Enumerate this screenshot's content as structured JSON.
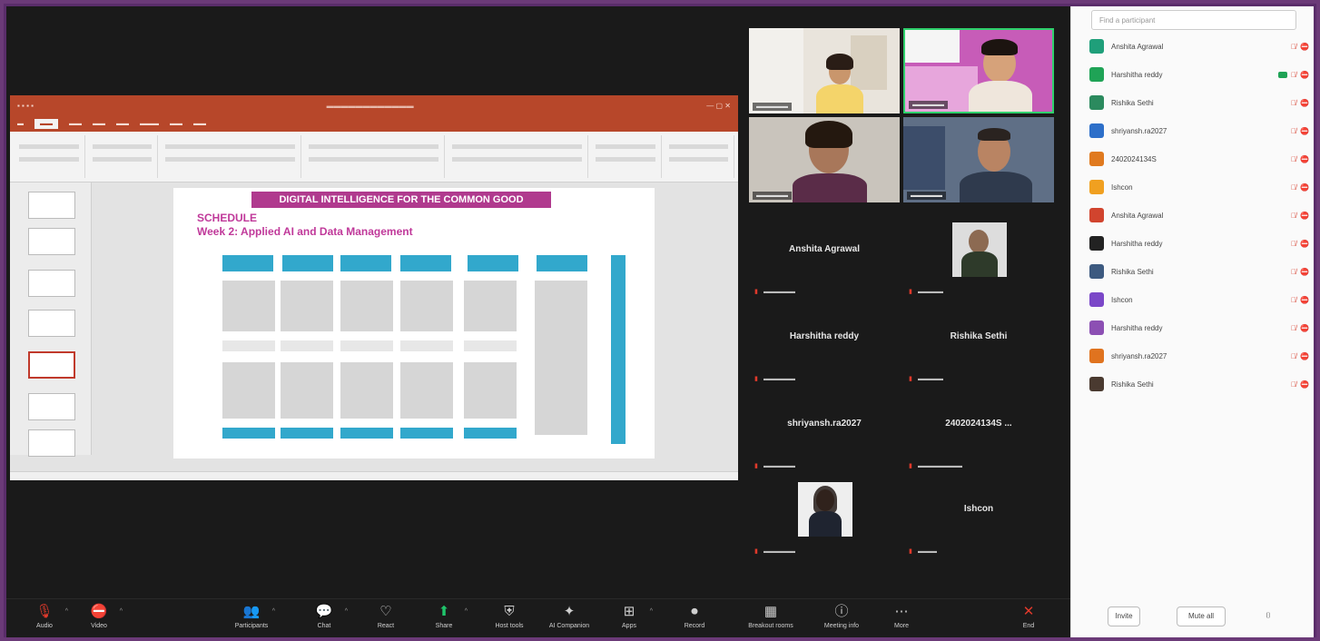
{
  "slide": {
    "banner": "DIGITAL INTELLIGENCE FOR THE COMMON GOOD",
    "heading": "SCHEDULE",
    "subheading": "Week 2: Applied AI and Data Management"
  },
  "tiles": [
    {
      "name": "Anshita Agrawal"
    },
    {
      "name": "Harshitha reddy"
    },
    {
      "name": "Rishika Sethi"
    },
    {
      "name": "shriyansh.ra2027"
    },
    {
      "name": "2402024134S ..."
    },
    {
      "name": "Ishcon"
    }
  ],
  "participants": [
    {
      "name": "Anshita Agrawal",
      "color": "#1f9f7a"
    },
    {
      "name": "Harshitha reddy",
      "color": "#1fa356"
    },
    {
      "name": "Rishika Sethi",
      "color": "#2b8a5e"
    },
    {
      "name": "shriyansh.ra2027",
      "color": "#2d6fc9"
    },
    {
      "name": "2402024134S",
      "color": "#e07a1f"
    },
    {
      "name": "Ishcon",
      "color": "#f0a020"
    },
    {
      "name": "Anshita Agrawal",
      "color": "#d1442e"
    },
    {
      "name": "Harshitha reddy",
      "color": "#222222"
    },
    {
      "name": "Rishika Sethi",
      "color": "#3d5a80"
    },
    {
      "name": "Ishcon",
      "color": "#7b47c8"
    },
    {
      "name": "Harshitha reddy",
      "color": "#8c4fb3"
    },
    {
      "name": "shriyansh.ra2027",
      "color": "#e0731f"
    },
    {
      "name": "Rishika Sethi",
      "color": "#4a3a30"
    }
  ],
  "toolbar": [
    {
      "label": "Audio",
      "icon": "mic-icon"
    },
    {
      "label": "Video",
      "icon": "video-icon"
    },
    {
      "label": "Participants",
      "icon": "participants-icon"
    },
    {
      "label": "Chat",
      "icon": "chat-icon"
    },
    {
      "label": "React",
      "icon": "react-icon"
    },
    {
      "label": "Share",
      "icon": "share-icon"
    },
    {
      "label": "Host tools",
      "icon": "shield-icon"
    },
    {
      "label": "AI Companion",
      "icon": "sparkle-icon"
    },
    {
      "label": "Apps",
      "icon": "apps-icon"
    },
    {
      "label": "Record",
      "icon": "record-icon"
    },
    {
      "label": "Breakout rooms",
      "icon": "breakout-icon"
    },
    {
      "label": "Meeting info",
      "icon": "info-icon"
    },
    {
      "label": "More",
      "icon": "more-icon"
    },
    {
      "label": "End",
      "icon": "end-icon"
    }
  ],
  "panel": {
    "search_placeholder": "Find a participant",
    "invite": "Invite",
    "mute_all": "Mute all"
  }
}
